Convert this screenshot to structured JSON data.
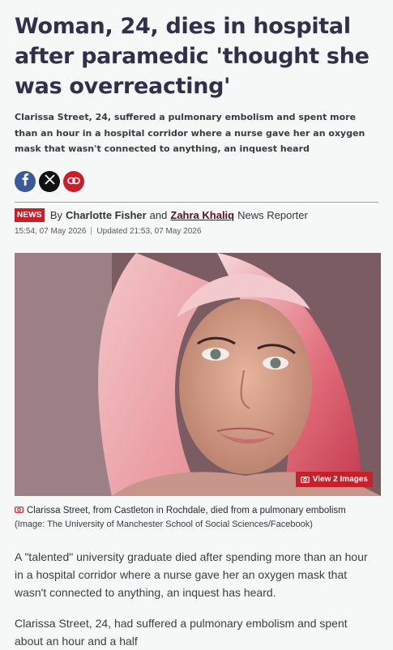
{
  "article": {
    "headline": "Woman, 24, dies in hospital after paramedic 'thought she was overreacting'",
    "standfirst": "Clarissa Street, 24, suffered a pulmonary embolism and spent more than an hour in a hospital corridor where a nurse gave her an oxygen mask that wasn't connected to anything, an inquest heard",
    "badge": "NEWS",
    "by": "By",
    "author1": "Charlotte Fisher",
    "and": "and",
    "author2": "Zahra Khaliq",
    "role": "News Reporter",
    "published": "15:54, 07 May 2026",
    "updated": "Updated 21:53, 07 May 2026",
    "view_images": "View 2 Images",
    "caption": "Clarissa Street, from Castleton in Rochdale, died from a pulmonary embolism",
    "credit": "(Image: The University of Manchester School of Social Sciences/Facebook)",
    "paragraph1": "A \"talented\" university graduate died after spending more than an hour in a hospital corridor where a nurse gave her an oxygen mask that wasn't connected to anything, an inquest has heard.",
    "paragraph2": "Clarissa Street, 24, had suffered a pulmonary embolism and spent about an hour and a half"
  },
  "icons": {
    "facebook": "facebook-icon",
    "x": "x-icon",
    "link": "link-icon",
    "camera": "camera-icon"
  },
  "colors": {
    "accent": "#c8202b",
    "headline": "#30304a",
    "facebook": "#3b5a9a"
  }
}
